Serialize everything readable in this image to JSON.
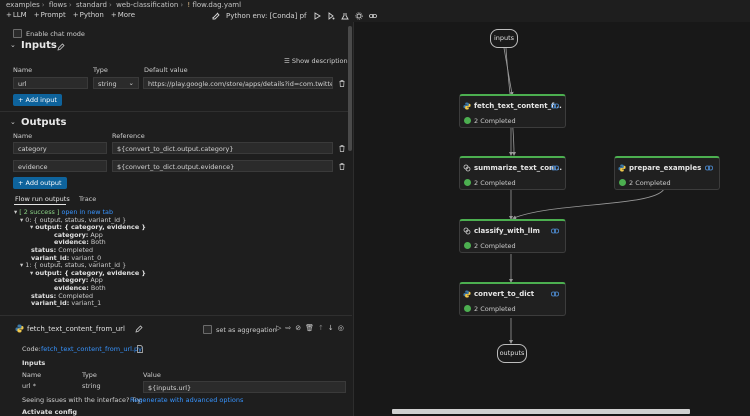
{
  "breadcrumb": [
    "examples",
    "flows",
    "standard",
    "web-classification",
    "flow.dag.yaml"
  ],
  "toolbar": {
    "llm": "LLM",
    "prompt": "Prompt",
    "python": "Python",
    "more": "More",
    "env": "Python env: [Conda] pf"
  },
  "chat_mode": "Enable chat mode",
  "inputs": {
    "heading": "Inputs",
    "show_description": "Show description",
    "col_name": "Name",
    "col_type": "Type",
    "col_default": "Default value",
    "row": {
      "name": "url",
      "type": "string",
      "default": "https://play.google.com/store/apps/details?id=com.twitter.android"
    },
    "add": "Add input"
  },
  "outputs": {
    "heading": "Outputs",
    "col_name": "Name",
    "col_ref": "Reference",
    "rows": [
      {
        "name": "category",
        "ref": "${convert_to_dict.output.category}"
      },
      {
        "name": "evidence",
        "ref": "${convert_to_dict.output.evidence}"
      }
    ],
    "add": "Add output"
  },
  "run_tabs": {
    "outputs": "Flow run outputs",
    "trace": "Trace"
  },
  "run_tree": {
    "summary": "[ 2 success ]",
    "open_tab": "open in new tab",
    "item0": "0: { output, status, variant_id }",
    "output0": "output: { category, evidence }",
    "cat0_k": "category:",
    "cat0_v": "App",
    "ev0_k": "evidence:",
    "ev0_v": "Both",
    "st0_k": "status:",
    "st0_v": "Completed",
    "var0_k": "variant_id:",
    "var0_v": "variant_0",
    "item1": "1: { output, status, variant_id }",
    "output1": "output: { category, evidence }",
    "cat1_k": "category:",
    "cat1_v": "App",
    "ev1_k": "evidence:",
    "ev1_v": "Both",
    "st1_k": "status:",
    "st1_v": "Completed",
    "var1_k": "variant_id:",
    "var1_v": "variant_1"
  },
  "node_detail": {
    "name": "fetch_text_content_from_url",
    "aggregation": "set as aggregation",
    "code_label": "Code:",
    "code_file": "fetch_text_content_from_url.py",
    "inputs_heading": "Inputs",
    "col_name": "Name",
    "col_type": "Type",
    "col_value": "Value",
    "row_name": "url",
    "row_required": "*",
    "row_type": "string",
    "row_value": "${inputs.url}",
    "issue_text": "Seeing issues with the interface? Try:",
    "issue_link": "Regenerate with advanced options",
    "activate": "Activate config"
  },
  "graph": {
    "inputs_label": "inputs",
    "outputs_label": "outputs",
    "nodes": {
      "fetch": {
        "title": "fetch_text_content_f...",
        "status": "2 Completed"
      },
      "summarize": {
        "title": "summarize_text_con...",
        "status": "2 Completed"
      },
      "prepare": {
        "title": "prepare_examples",
        "status": "2 Completed"
      },
      "classify": {
        "title": "classify_with_llm",
        "status": "2 Completed"
      },
      "convert": {
        "title": "convert_to_dict",
        "status": "2 Completed"
      }
    }
  },
  "colors": {
    "accent": "#0e639c",
    "success": "#4caf50",
    "link": "#3794ff"
  }
}
